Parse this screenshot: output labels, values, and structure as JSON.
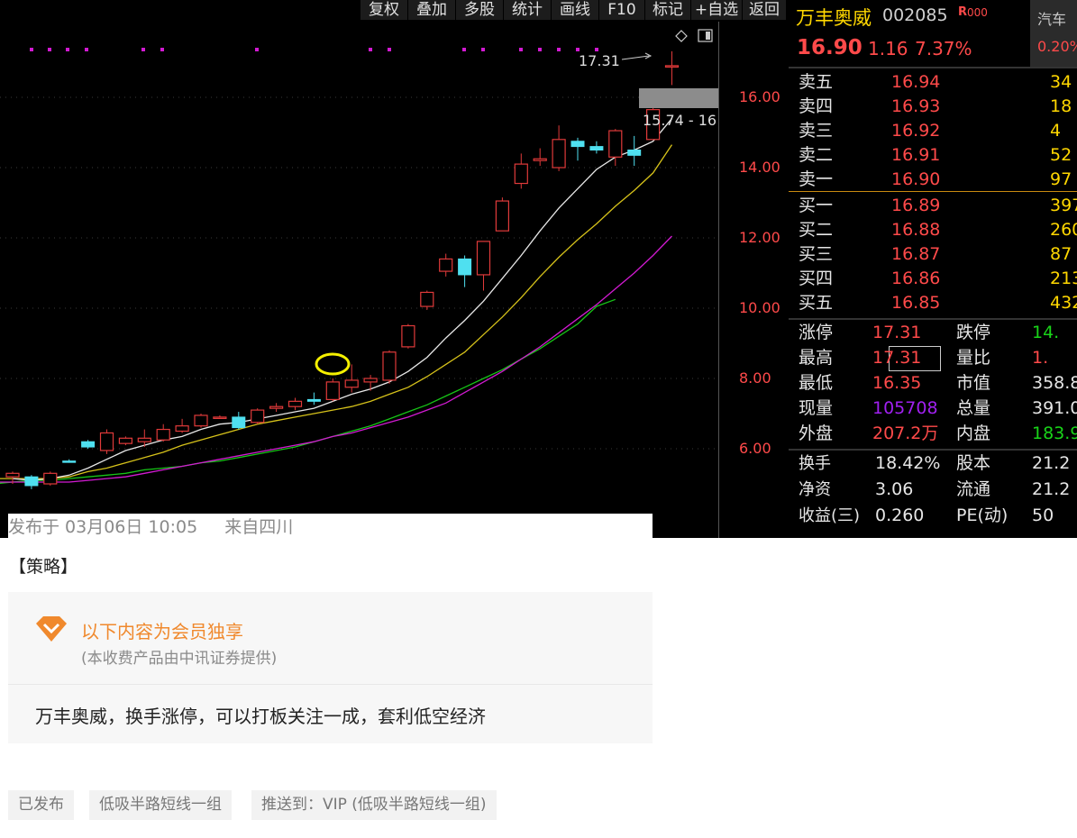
{
  "toolbar": {
    "buttons": [
      "复权",
      "叠加",
      "多股",
      "统计",
      "画线",
      "F10",
      "标记",
      "+自选",
      "返回"
    ]
  },
  "chart": {
    "price_axis_labels": [
      "16.00",
      "14.00",
      "12.00",
      "10.00",
      "8.00",
      "6.00"
    ],
    "high_marker": "17.31",
    "range_label": "15.74 - 16",
    "colors": {
      "up": "#e03a3a",
      "down": "#4fe0f0",
      "ma5": "#e8e8e8",
      "ma10": "#d6c21a",
      "ma20": "#d21ad2",
      "ma60": "#17c417",
      "annotation": "#f5f000"
    },
    "icons": [
      "diamond-icon",
      "panel-toggle-icon"
    ]
  },
  "chart_data": {
    "type": "candlestick",
    "ylim": [
      4.9,
      17.8
    ],
    "candles": [
      {
        "o": 5.2,
        "h": 5.35,
        "l": 5.0,
        "c": 5.3
      },
      {
        "o": 5.2,
        "h": 5.25,
        "l": 4.85,
        "c": 4.95
      },
      {
        "o": 5.0,
        "h": 5.35,
        "l": 4.95,
        "c": 5.3
      },
      {
        "o": 5.65,
        "h": 5.7,
        "l": 5.6,
        "c": 5.65
      },
      {
        "o": 6.2,
        "h": 6.25,
        "l": 6.0,
        "c": 6.05
      },
      {
        "o": 5.95,
        "h": 6.55,
        "l": 5.85,
        "c": 6.45
      },
      {
        "o": 6.15,
        "h": 6.35,
        "l": 6.1,
        "c": 6.3
      },
      {
        "o": 6.2,
        "h": 6.55,
        "l": 6.05,
        "c": 6.3
      },
      {
        "o": 6.25,
        "h": 6.7,
        "l": 6.2,
        "c": 6.55
      },
      {
        "o": 6.5,
        "h": 6.85,
        "l": 6.45,
        "c": 6.65
      },
      {
        "o": 6.65,
        "h": 7.0,
        "l": 6.6,
        "c": 6.95
      },
      {
        "o": 6.9,
        "h": 6.95,
        "l": 6.85,
        "c": 6.9
      },
      {
        "o": 6.9,
        "h": 7.05,
        "l": 6.55,
        "c": 6.6
      },
      {
        "o": 6.75,
        "h": 7.15,
        "l": 6.7,
        "c": 7.1
      },
      {
        "o": 7.15,
        "h": 7.3,
        "l": 7.05,
        "c": 7.2
      },
      {
        "o": 7.2,
        "h": 7.45,
        "l": 7.1,
        "c": 7.35
      },
      {
        "o": 7.4,
        "h": 7.6,
        "l": 7.25,
        "c": 7.35
      },
      {
        "o": 7.4,
        "h": 8.0,
        "l": 7.35,
        "c": 7.9
      },
      {
        "o": 7.75,
        "h": 8.4,
        "l": 7.6,
        "c": 7.95
      },
      {
        "o": 7.9,
        "h": 8.1,
        "l": 7.65,
        "c": 8.0
      },
      {
        "o": 7.95,
        "h": 8.8,
        "l": 7.85,
        "c": 8.75
      },
      {
        "o": 8.9,
        "h": 9.55,
        "l": 8.85,
        "c": 9.5
      },
      {
        "o": 10.05,
        "h": 10.5,
        "l": 9.95,
        "c": 10.45
      },
      {
        "o": 11.05,
        "h": 11.55,
        "l": 10.9,
        "c": 11.4
      },
      {
        "o": 11.4,
        "h": 11.5,
        "l": 10.6,
        "c": 10.95
      },
      {
        "o": 10.95,
        "h": 11.9,
        "l": 10.5,
        "c": 11.9
      },
      {
        "o": 12.2,
        "h": 13.15,
        "l": 12.2,
        "c": 13.05
      },
      {
        "o": 13.55,
        "h": 14.4,
        "l": 13.4,
        "c": 14.1
      },
      {
        "o": 14.2,
        "h": 14.55,
        "l": 14.05,
        "c": 14.25
      },
      {
        "o": 14.0,
        "h": 15.2,
        "l": 13.9,
        "c": 14.8
      },
      {
        "o": 14.75,
        "h": 14.85,
        "l": 14.2,
        "c": 14.6
      },
      {
        "o": 14.6,
        "h": 14.75,
        "l": 14.4,
        "c": 14.5
      },
      {
        "o": 14.3,
        "h": 15.1,
        "l": 14.05,
        "c": 15.05
      },
      {
        "o": 14.5,
        "h": 14.9,
        "l": 14.05,
        "c": 14.35
      },
      {
        "o": 14.8,
        "h": 15.8,
        "l": 14.8,
        "c": 15.65
      },
      {
        "o": 16.9,
        "h": 17.31,
        "l": 16.35,
        "c": 16.9
      }
    ],
    "ma5": [
      5.15,
      5.1,
      5.15,
      5.25,
      5.45,
      5.7,
      5.95,
      6.1,
      6.25,
      6.35,
      6.55,
      6.7,
      6.75,
      6.85,
      6.95,
      7.05,
      7.15,
      7.35,
      7.55,
      7.7,
      7.9,
      8.2,
      8.6,
      9.15,
      9.65,
      10.2,
      10.85,
      11.5,
      12.2,
      12.85,
      13.4,
      13.95,
      14.3,
      14.5,
      14.75,
      15.4
    ],
    "ma10": [
      5.15,
      5.15,
      5.15,
      5.15,
      5.2,
      5.35,
      5.45,
      5.6,
      5.75,
      5.9,
      6.1,
      6.25,
      6.4,
      6.55,
      6.7,
      6.8,
      6.9,
      7.0,
      7.1,
      7.2,
      7.35,
      7.55,
      7.75,
      8.05,
      8.4,
      8.75,
      9.25,
      9.75,
      10.3,
      10.9,
      11.45,
      11.95,
      12.4,
      12.9,
      13.35,
      13.85,
      14.65
    ],
    "ma20": [
      5.05,
      5.05,
      5.05,
      5.05,
      5.05,
      5.1,
      5.15,
      5.2,
      5.3,
      5.4,
      5.5,
      5.6,
      5.7,
      5.8,
      5.9,
      6.0,
      6.1,
      6.2,
      6.35,
      6.45,
      6.6,
      6.75,
      6.9,
      7.1,
      7.3,
      7.6,
      7.9,
      8.2,
      8.55,
      8.9,
      9.3,
      9.7,
      10.1,
      10.55,
      11.0,
      11.5,
      12.05
    ],
    "ma60": [
      4.95,
      4.95,
      4.95,
      4.95,
      5.0,
      5.0,
      5.05,
      5.1,
      5.1,
      5.15,
      5.2,
      5.25,
      5.3,
      5.4,
      5.45,
      5.5,
      5.6,
      5.65,
      5.75,
      5.85,
      5.95,
      6.05,
      6.2,
      6.35,
      6.5,
      6.65,
      6.85,
      7.05,
      7.25,
      7.5,
      7.75,
      8.0,
      8.25,
      8.55,
      8.85,
      9.2,
      9.55,
      10.05,
      10.25
    ]
  },
  "quote": {
    "name": "万丰奥威",
    "code": "002085",
    "badge": "R",
    "badge2": "000",
    "sector": "汽车",
    "sector_pct": "0.20%",
    "price": "16.90",
    "change": "1.16",
    "change_pct": "7.37%",
    "asks": [
      {
        "label": "卖五",
        "price": "16.94",
        "vol": "34"
      },
      {
        "label": "卖四",
        "price": "16.93",
        "vol": "18"
      },
      {
        "label": "卖三",
        "price": "16.92",
        "vol": "4"
      },
      {
        "label": "卖二",
        "price": "16.91",
        "vol": "52"
      },
      {
        "label": "卖一",
        "price": "16.90",
        "vol": "97"
      }
    ],
    "bids": [
      {
        "label": "买一",
        "price": "16.89",
        "vol": "397"
      },
      {
        "label": "买二",
        "price": "16.88",
        "vol": "260"
      },
      {
        "label": "买三",
        "price": "16.87",
        "vol": "87"
      },
      {
        "label": "买四",
        "price": "16.86",
        "vol": "213"
      },
      {
        "label": "买五",
        "price": "16.85",
        "vol": "432"
      }
    ],
    "stats": [
      {
        "l1": "涨停",
        "v1": "17.31",
        "c1": "red",
        "l2": "跌停",
        "v2": "14.",
        "c2": "green"
      },
      {
        "l1": "最高",
        "v1": "17.31",
        "c1": "red",
        "l2": "量比",
        "v2": "1.",
        "c2": "red"
      },
      {
        "l1": "最低",
        "v1": "16.35",
        "c1": "red",
        "l2": "市值",
        "v2": "358.8",
        "c2": "white"
      },
      {
        "l1": "现量",
        "v1": "105708",
        "c1": "purple",
        "l2": "总量",
        "v2": "391.0",
        "c2": "white"
      },
      {
        "l1": "外盘",
        "v1": "207.2万",
        "c1": "red",
        "l2": "内盘",
        "v2": "183.9",
        "c2": "green"
      }
    ],
    "stats2": [
      {
        "l1": "换手",
        "v1": "18.42%",
        "l2": "股本",
        "v2": "21.2"
      },
      {
        "l1": "净资",
        "v1": "3.06",
        "l2": "流通",
        "v2": "21.2"
      },
      {
        "l1": "收益(三)",
        "v1": "0.260",
        "l2": "PE(动)",
        "v2": "50"
      }
    ]
  },
  "post": {
    "meta_time": "发布于 03月06日 10:05",
    "meta_location": "来自四川",
    "strategy_title": "【策略】",
    "member_title": "以下内容为会员独享",
    "member_sub": "(本收费产品由中讯证券提供)",
    "member_text": "万丰奥威，换手涨停，可以打板关注一成，套利低空经济",
    "tags": [
      "已发布",
      "低吸半路短线一组",
      "推送到：VIP (低吸半路短线一组)"
    ]
  }
}
